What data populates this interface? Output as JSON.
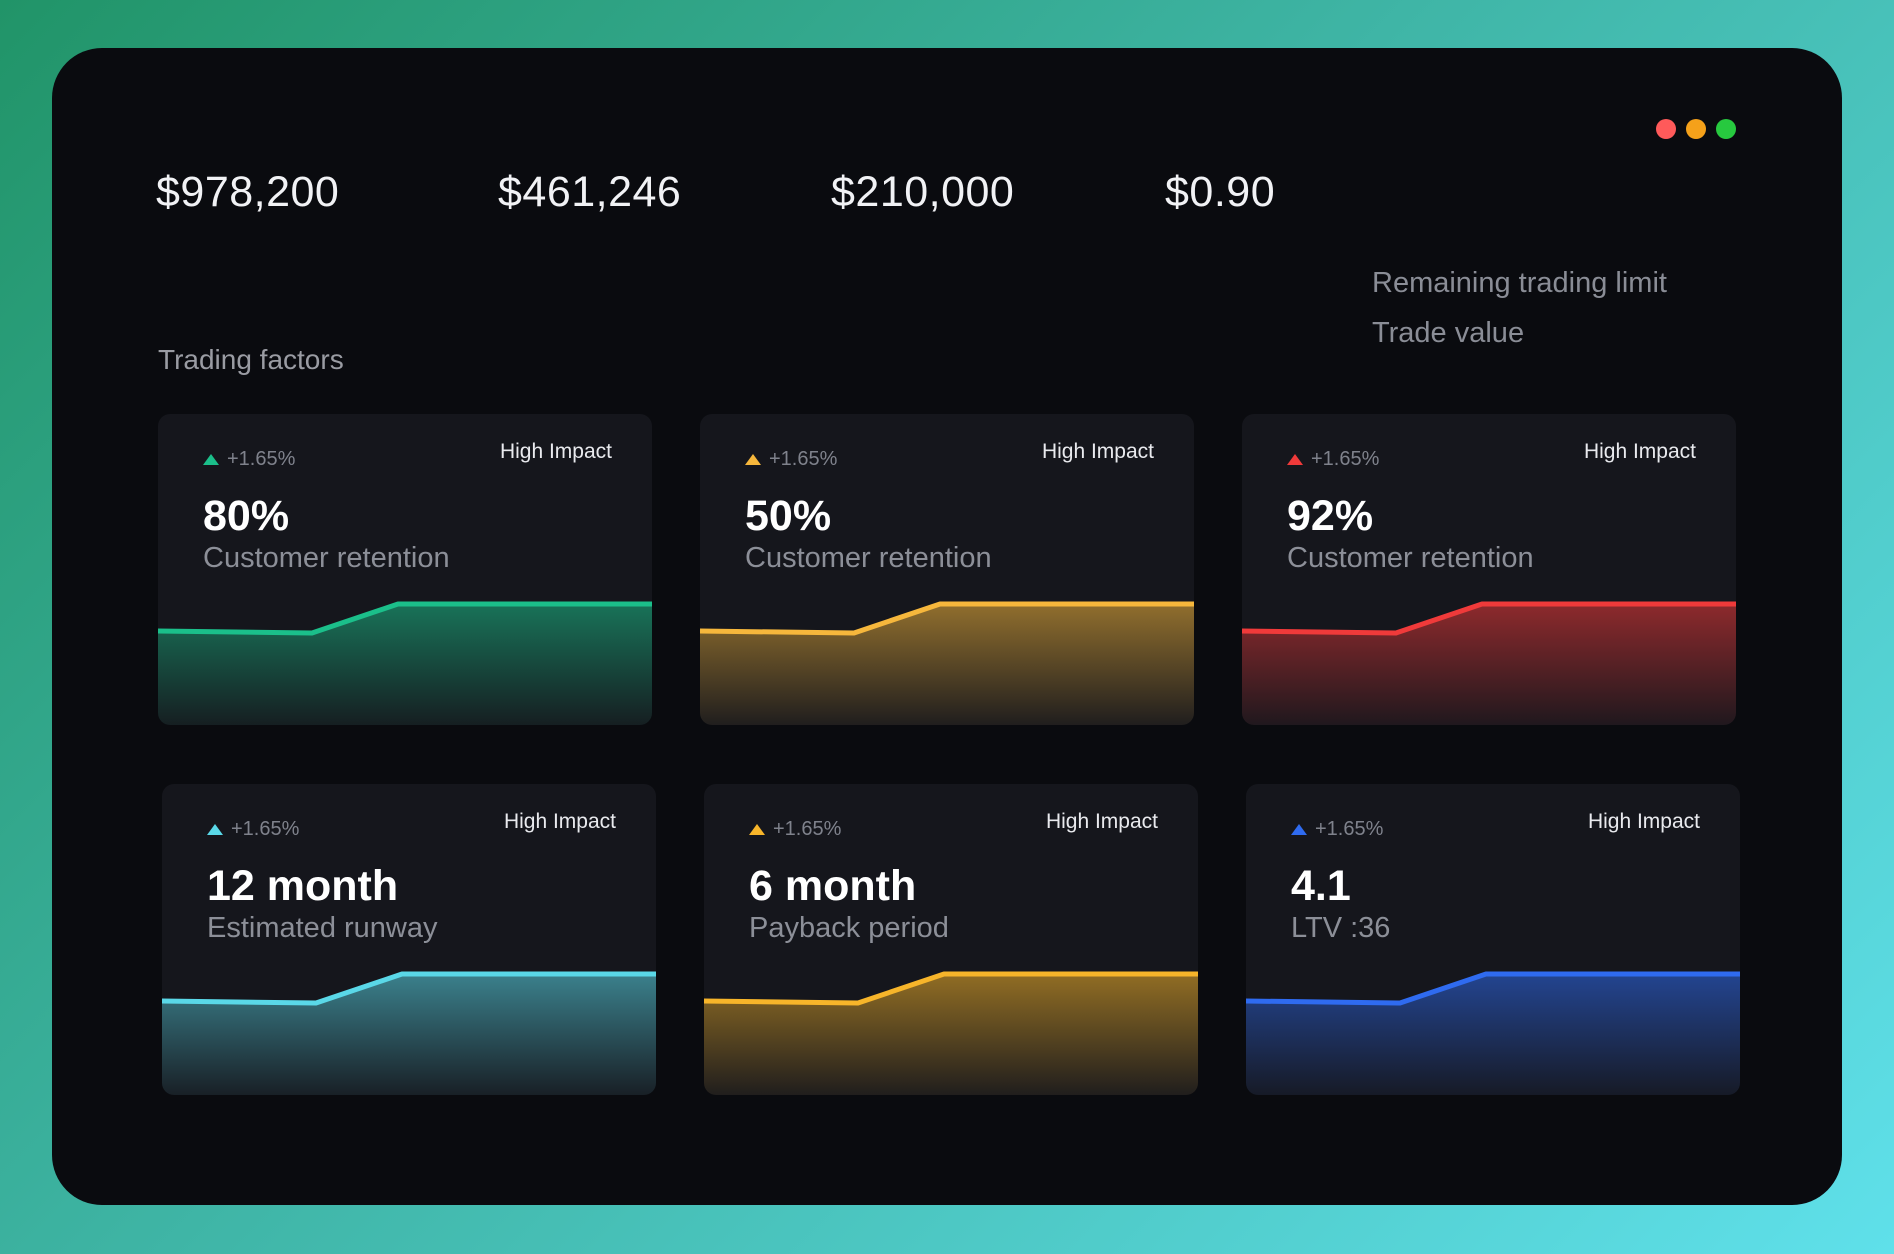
{
  "window": {
    "controls": [
      "close",
      "minimize",
      "maximize"
    ]
  },
  "stats": [
    "$978,200",
    "$461,246",
    "$210,000",
    "$0.90"
  ],
  "side_labels": [
    "Remaining trading limit",
    "Trade value"
  ],
  "section_title": "Trading factors",
  "cards": [
    {
      "delta": "+1.65%",
      "impact": "High Impact",
      "value": "80%",
      "caption": "Customer retention",
      "color": "#1bbf8a",
      "icon": "triangle-up-icon"
    },
    {
      "delta": "+1.65%",
      "impact": "High Impact",
      "value": "50%",
      "caption": "Customer retention",
      "color": "#f6b73c",
      "icon": "triangle-up-icon"
    },
    {
      "delta": "+1.65%",
      "impact": "High Impact",
      "value": "92%",
      "caption": "Customer retention",
      "color": "#f03a3a",
      "icon": "triangle-up-icon"
    },
    {
      "delta": "+1.65%",
      "impact": "High Impact",
      "value": "12 month",
      "caption": "Estimated runway",
      "color": "#5ad8e8",
      "icon": "triangle-up-icon"
    },
    {
      "delta": "+1.65%",
      "impact": "High Impact",
      "value": "6 month",
      "caption": "Payback period",
      "color": "#f7b52a",
      "icon": "triangle-up-icon"
    },
    {
      "delta": "+1.65%",
      "impact": "High Impact",
      "value": "4.1",
      "caption": "LTV :36",
      "color": "#2f6bf0",
      "icon": "triangle-up-icon"
    }
  ]
}
